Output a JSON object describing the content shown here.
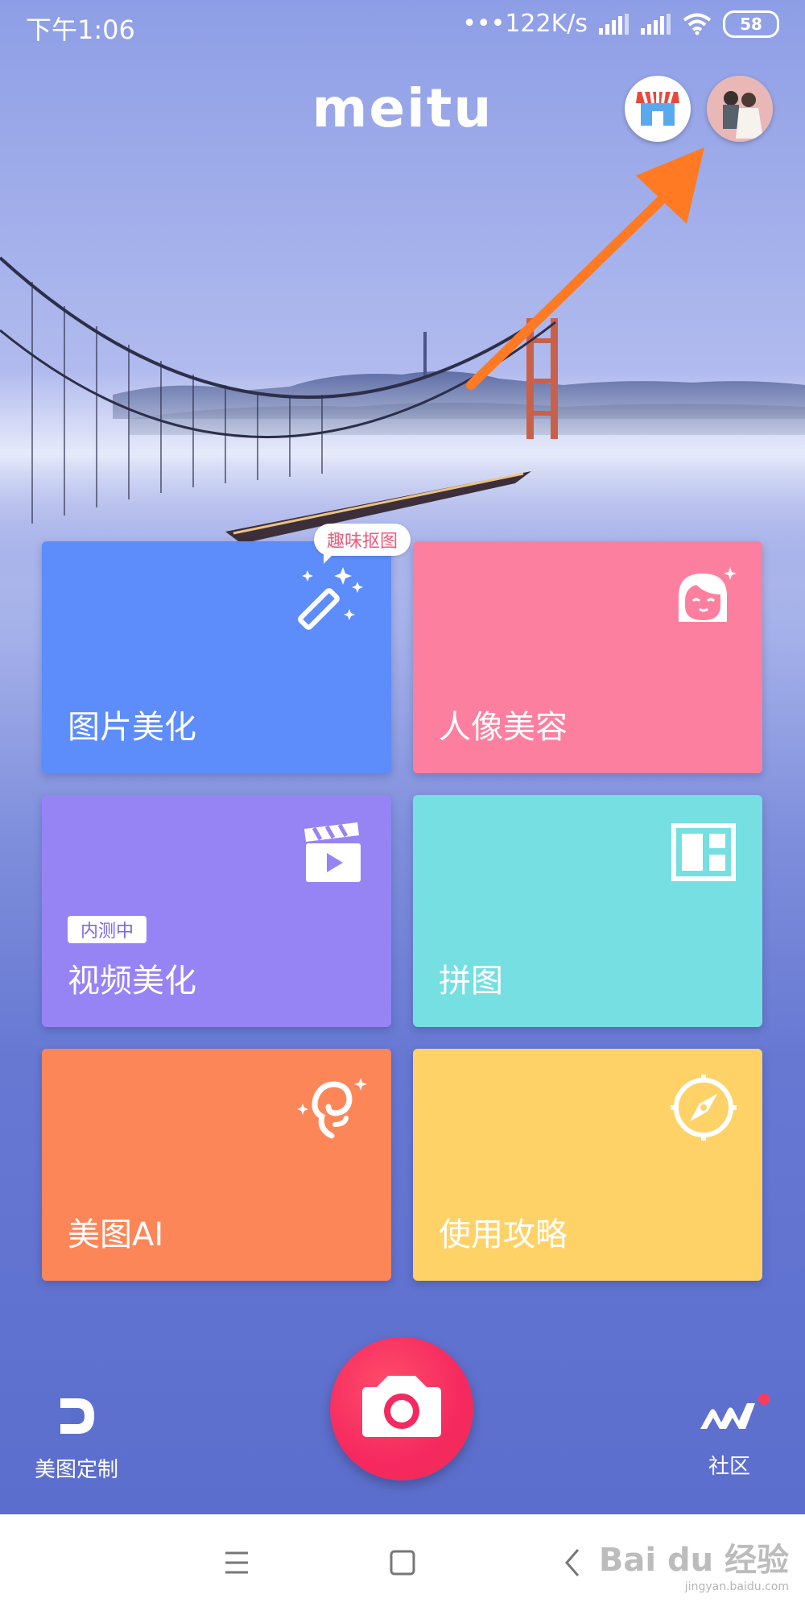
{
  "status_bar": {
    "time": "下午1:06",
    "network_speed": "•••122K/s",
    "battery": "58"
  },
  "header": {
    "logo": "meitu",
    "store_icon": "store-icon",
    "avatar_icon": "avatar-icon"
  },
  "tiles": {
    "photo": {
      "label": "图片美化",
      "bubble": "趣味抠图",
      "icon": "magic-wand-icon"
    },
    "portrait": {
      "label": "人像美容",
      "icon": "face-icon"
    },
    "video": {
      "label": "视频美化",
      "badge": "内测中",
      "icon": "clapper-icon"
    },
    "collage": {
      "label": "拼图",
      "icon": "collage-icon"
    },
    "ai": {
      "label": "美图AI",
      "icon": "ai-swirl-icon"
    },
    "guide": {
      "label": "使用攻略",
      "icon": "compass-icon"
    }
  },
  "bottom": {
    "custom_label": "美图定制",
    "community_label": "社区",
    "camera_icon": "camera-icon"
  },
  "watermark": {
    "text": "Bai du 经验",
    "url": "jingyan.baidu.com"
  },
  "colors": {
    "photo": "#5d8cfb",
    "portrait": "#fd7f9f",
    "video": "#9684f5",
    "collage": "#75dfe2",
    "ai": "#fd8659",
    "guide": "#fed267",
    "camera": "#f5295f",
    "arrow": "#ff7a22"
  }
}
